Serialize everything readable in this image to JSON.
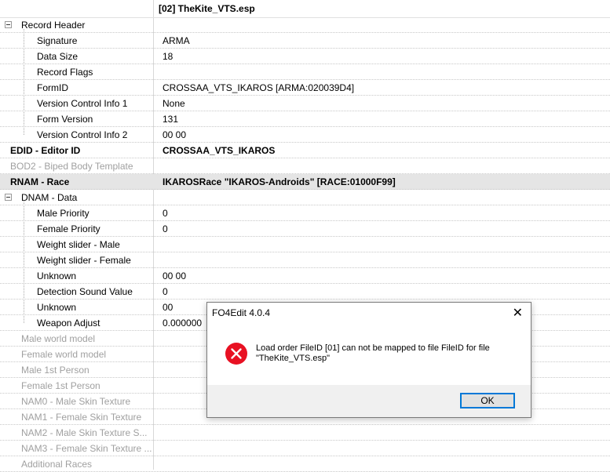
{
  "header": {
    "file_title": "[02] TheKite_VTS.esp"
  },
  "rows": [
    {
      "name": "Record Header",
      "value": ""
    },
    {
      "name": "Signature",
      "value": "ARMA"
    },
    {
      "name": "Data Size",
      "value": "18"
    },
    {
      "name": "Record Flags",
      "value": ""
    },
    {
      "name": "FormID",
      "value": "CROSSAA_VTS_IKAROS [ARMA:020039D4]"
    },
    {
      "name": "Version Control Info 1",
      "value": "None"
    },
    {
      "name": "Form Version",
      "value": "131"
    },
    {
      "name": "Version Control Info 2",
      "value": "00 00"
    },
    {
      "name": "EDID - Editor ID",
      "value": "CROSSAA_VTS_IKAROS"
    },
    {
      "name": "BOD2 - Biped Body Template",
      "value": ""
    },
    {
      "name": "RNAM - Race",
      "value": "IKAROSRace \"IKAROS-Androids\" [RACE:01000F99]"
    },
    {
      "name": "DNAM - Data",
      "value": ""
    },
    {
      "name": "Male Priority",
      "value": "0"
    },
    {
      "name": "Female Priority",
      "value": "0"
    },
    {
      "name": "Weight slider - Male",
      "value": ""
    },
    {
      "name": "Weight slider - Female",
      "value": ""
    },
    {
      "name": "Unknown",
      "value": "00 00"
    },
    {
      "name": "Detection Sound Value",
      "value": "0"
    },
    {
      "name": "Unknown",
      "value": "00"
    },
    {
      "name": "Weapon Adjust",
      "value": "0.000000"
    },
    {
      "name": "Male world model",
      "value": ""
    },
    {
      "name": "Female world model",
      "value": ""
    },
    {
      "name": "Male 1st Person",
      "value": ""
    },
    {
      "name": "Female 1st Person",
      "value": ""
    },
    {
      "name": "NAM0 - Male Skin Texture",
      "value": ""
    },
    {
      "name": "NAM1 - Female Skin Texture",
      "value": ""
    },
    {
      "name": "NAM2 - Male Skin Texture S...",
      "value": ""
    },
    {
      "name": "NAM3 - Female Skin Texture ...",
      "value": ""
    },
    {
      "name": "Additional Races",
      "value": ""
    }
  ],
  "dialog": {
    "title": "FO4Edit 4.0.4",
    "close_glyph": "✕",
    "message": "Load order FileID [01] can not be mapped to file FileID for file \"TheKite_VTS.esp\"",
    "ok_label": "OK",
    "error_color": "#e81123"
  }
}
